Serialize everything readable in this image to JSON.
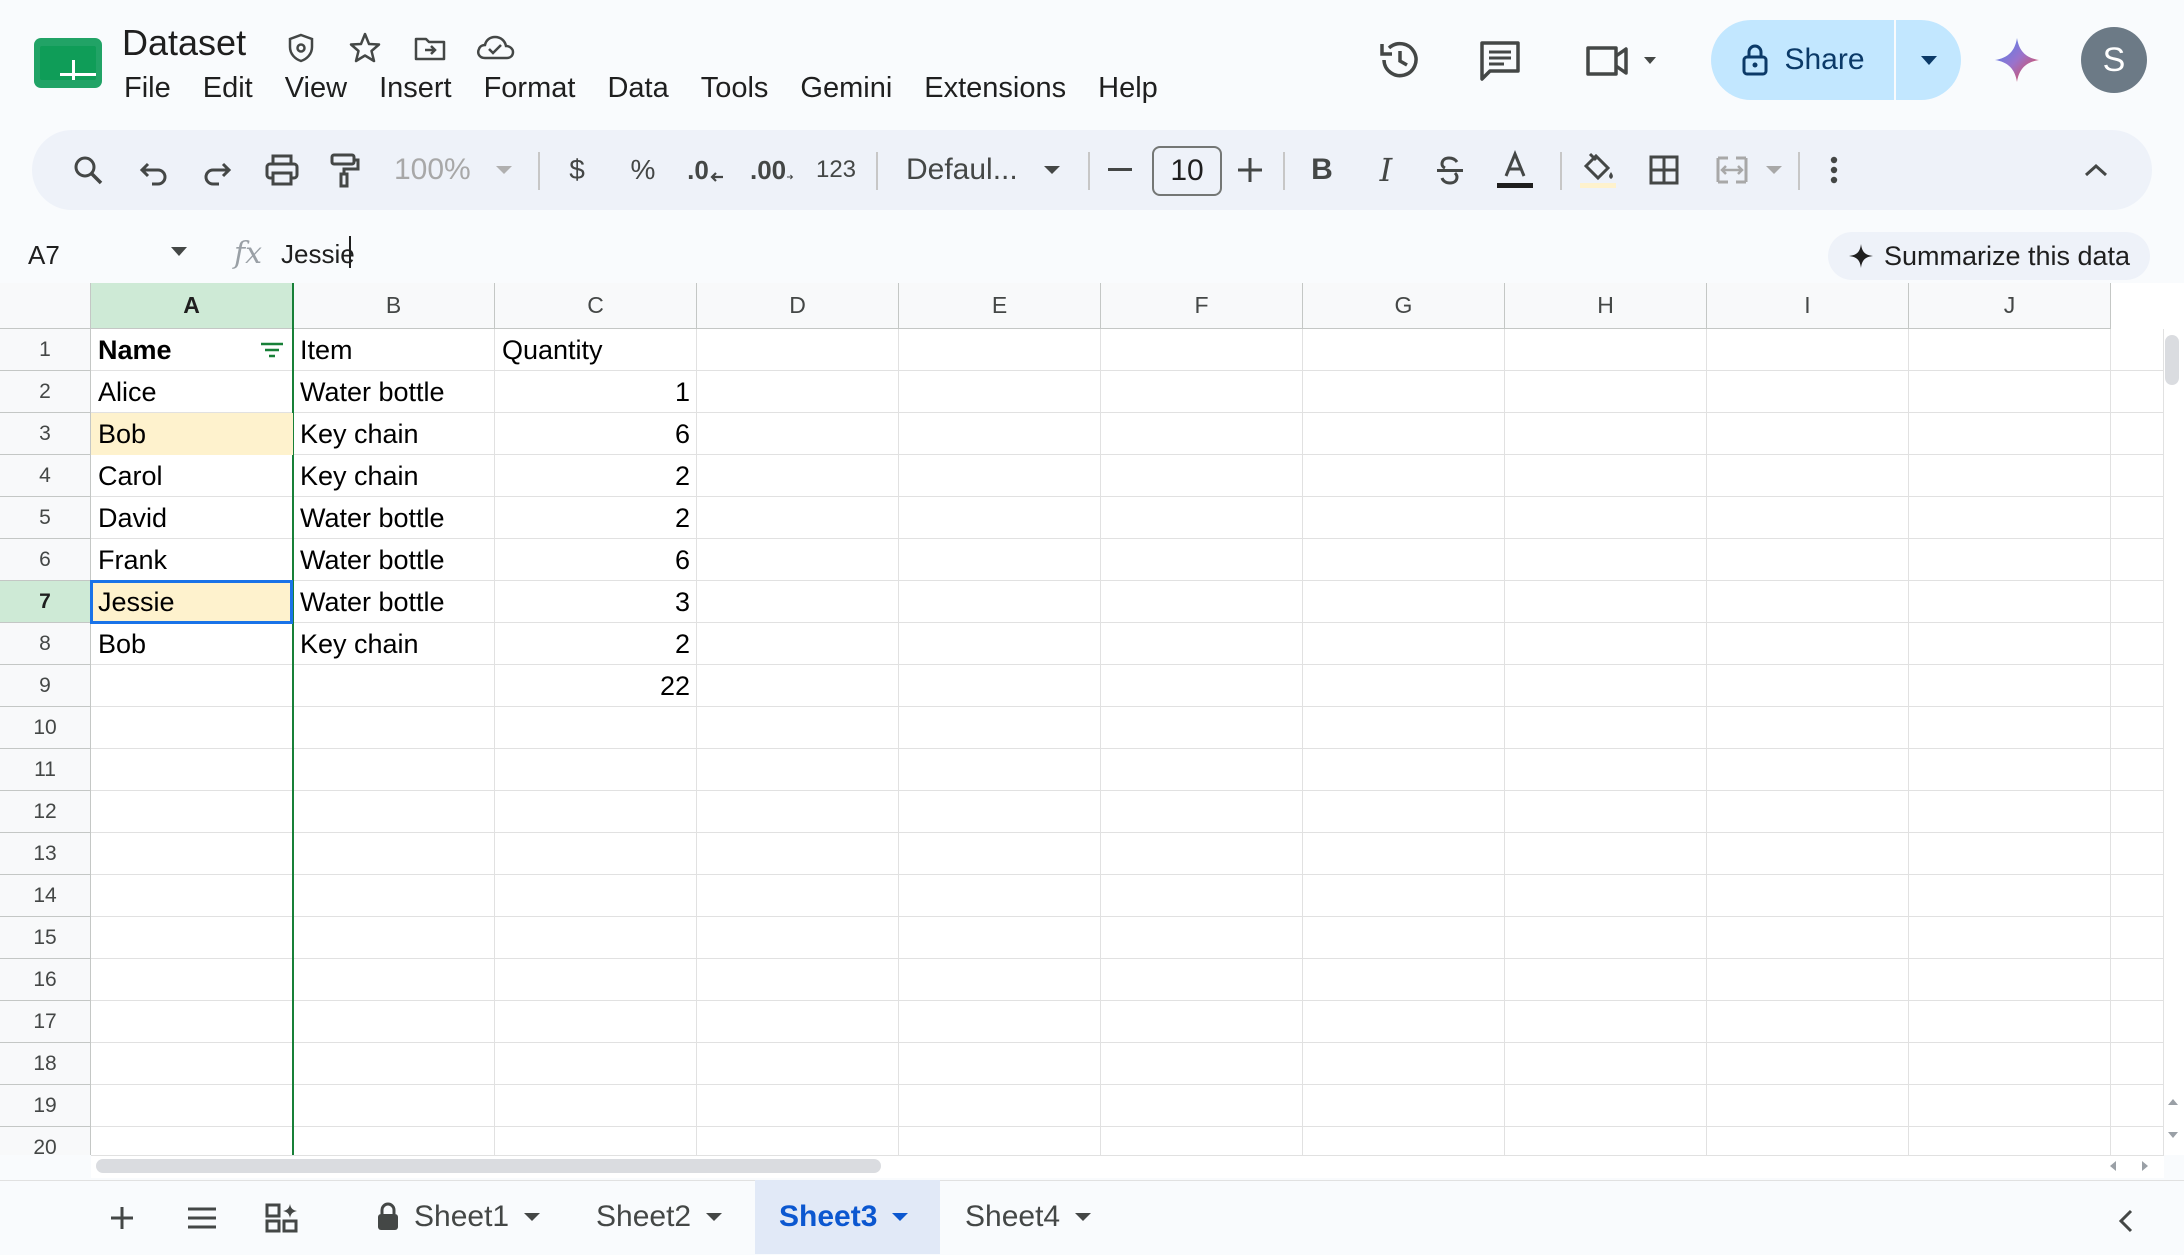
{
  "app": {
    "title": "Dataset",
    "menu": [
      "File",
      "Edit",
      "View",
      "Insert",
      "Format",
      "Data",
      "Tools",
      "Gemini",
      "Extensions",
      "Help"
    ],
    "share_label": "Share",
    "avatar_initial": "S",
    "brand_color": "#0f9d58",
    "share_color": "#c2e7ff"
  },
  "toolbar": {
    "zoom": "100%",
    "currency": "$",
    "percent": "%",
    "decrease_decimal": ".0",
    "increase_decimal": ".00",
    "number_format": "123",
    "font_name": "Defaul...",
    "font_size": "10",
    "bold": "B",
    "italic": "I"
  },
  "formula_bar": {
    "cell_ref": "A7",
    "fx": "fx",
    "value": "Jessie",
    "summarize_label": "Summarize this data"
  },
  "grid": {
    "columns": [
      "A",
      "B",
      "C",
      "D",
      "E",
      "F",
      "G",
      "H",
      "I",
      "J"
    ],
    "rows": [
      "1",
      "2",
      "3",
      "4",
      "5",
      "6",
      "7",
      "8",
      "9",
      "10",
      "11",
      "12",
      "13",
      "14",
      "15",
      "16",
      "17",
      "18",
      "19",
      "20"
    ],
    "header": {
      "name": "Name",
      "item": "Item",
      "quantity": "Quantity"
    },
    "data": [
      {
        "name": "Alice",
        "item": "Water bottle",
        "qty": "1"
      },
      {
        "name": "Bob",
        "item": "Key chain",
        "qty": "6"
      },
      {
        "name": "Carol",
        "item": "Key chain",
        "qty": "2"
      },
      {
        "name": "David",
        "item": "Water bottle",
        "qty": "2"
      },
      {
        "name": "Frank",
        "item": "Water bottle",
        "qty": "6"
      },
      {
        "name": "Jessie",
        "item": "Water bottle",
        "qty": "3"
      },
      {
        "name": "Bob",
        "item": "Key chain",
        "qty": "2"
      }
    ],
    "total": "22",
    "selected_cell": "A7",
    "highlight_color": "#fef2cd",
    "selection_color": "#1a73e8"
  },
  "sheets": {
    "tabs": [
      "Sheet1",
      "Sheet2",
      "Sheet3",
      "Sheet4"
    ],
    "active": "Sheet3"
  }
}
